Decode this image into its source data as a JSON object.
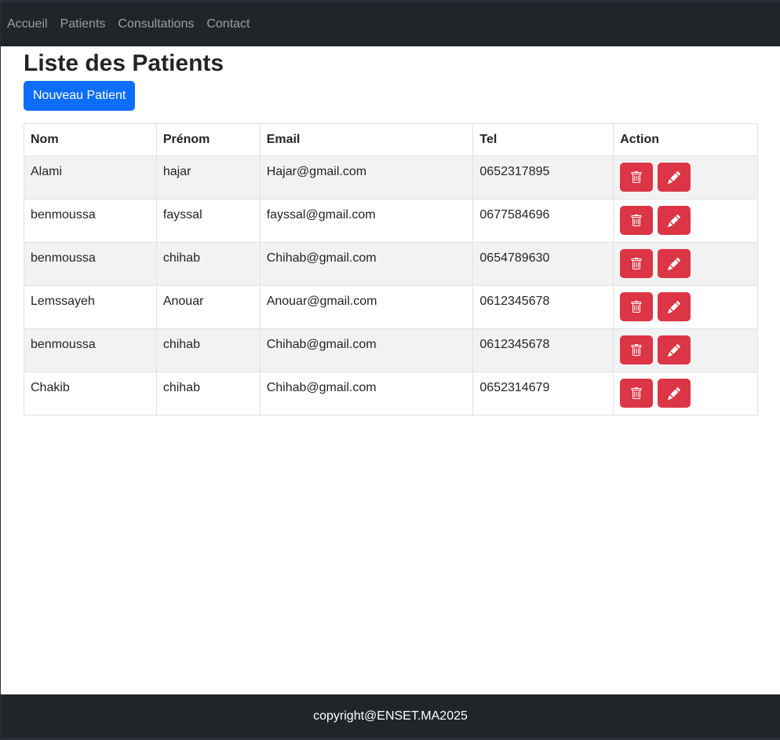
{
  "nav": {
    "links": [
      "Accueil",
      "Patients",
      "Consultations",
      "Contact"
    ]
  },
  "page": {
    "title": "Liste des Patients",
    "new_button": "Nouveau Patient"
  },
  "table": {
    "headers": [
      "Nom",
      "Prénom",
      "Email",
      "Tel",
      "Action"
    ],
    "rows": [
      [
        "Alami",
        "hajar",
        "Hajar@gmail.com",
        "0652317895"
      ],
      [
        "benmoussa",
        "fayssal",
        "fayssal@gmail.com",
        "0677584696"
      ],
      [
        "benmoussa",
        "chihab",
        "Chihab@gmail.com",
        "0654789630"
      ],
      [
        "Lemssayeh",
        "Anouar",
        "Anouar@gmail.com",
        "0612345678"
      ],
      [
        "benmoussa",
        "chihab",
        "Chihab@gmail.com",
        "0612345678"
      ],
      [
        "Chakib",
        "chihab",
        "Chihab@gmail.com",
        "0652314679"
      ]
    ],
    "action_icons": [
      "trash-icon",
      "pencil-icon"
    ]
  },
  "footer": {
    "text": "copyright@ENSET.MA2025"
  },
  "colors": {
    "navbar": "#212529",
    "primary": "#0d6efd",
    "danger": "#dc3545",
    "striped_row": "#f2f2f2"
  }
}
